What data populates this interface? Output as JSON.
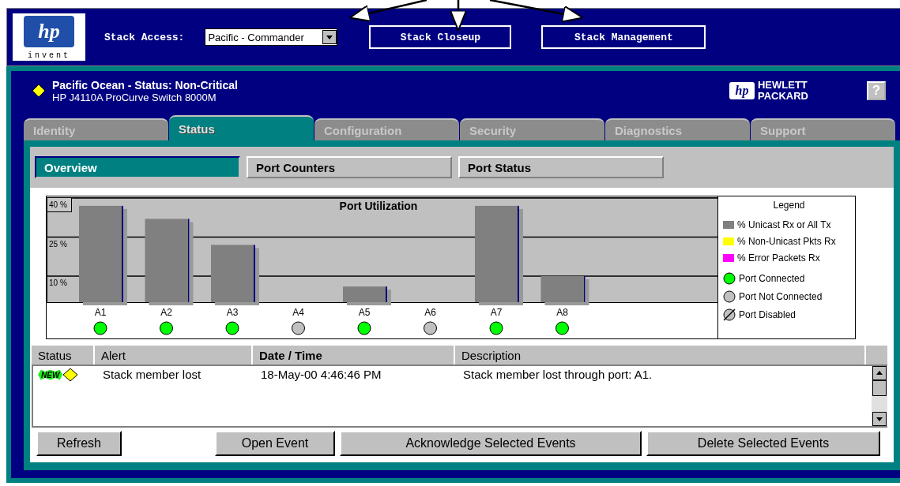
{
  "header": {
    "logo": {
      "mark": "hp",
      "tagline": "invent"
    },
    "stack_access": {
      "label": "Stack Access:",
      "value": "Pacific - Commander"
    },
    "buttons": [
      "Stack Closeup",
      "Stack Management"
    ]
  },
  "device": {
    "title": "Pacific Ocean - Status: Non-Critical",
    "color": "#ffff00",
    "model": "HP J4110A ProCurve Switch 8000M",
    "brand": {
      "mark": "hp",
      "line1": "HEWLETT",
      "line2": "PACKARD"
    },
    "help": "?"
  },
  "tabs": [
    {
      "label": "Identity",
      "selected": false
    },
    {
      "label": "Status",
      "selected": true
    },
    {
      "label": "Configuration",
      "selected": false
    },
    {
      "label": "Security",
      "selected": false
    },
    {
      "label": "Diagnostics",
      "selected": false
    },
    {
      "label": "Support",
      "selected": false
    }
  ],
  "subtabs": [
    {
      "label": "Overview",
      "selected": true
    },
    {
      "label": "Port Counters",
      "selected": false
    },
    {
      "label": "Port Status",
      "selected": false
    }
  ],
  "chart": {
    "chart_data": {
      "type": "bar",
      "title": "Port Utilization",
      "categories": [
        "A1",
        "A2",
        "A3",
        "A4",
        "A5",
        "A6",
        "A7",
        "A8"
      ],
      "series": [
        {
          "color": "#808080",
          "values": [
            37,
            32,
            22,
            0,
            6,
            0,
            37,
            10
          ]
        }
      ],
      "ylim": [
        0,
        40
      ],
      "yticks": [
        {
          "value": 10,
          "label": "10 %"
        },
        {
          "value": 25,
          "label": "25 %"
        },
        {
          "value": 40,
          "label": "40 %"
        }
      ]
    },
    "port_links": [
      {
        "connected": true
      },
      {
        "connected": true
      },
      {
        "connected": true
      },
      {
        "connected": false
      },
      {
        "connected": true
      },
      {
        "connected": false
      },
      {
        "connected": true
      },
      {
        "connected": true
      }
    ]
  },
  "legend": {
    "title": "Legend",
    "items": [
      {
        "kind": "swatch",
        "color": "#808080",
        "label": "% Unicast Rx or All Tx"
      },
      {
        "kind": "swatch",
        "color": "#ffff00",
        "label": "% Non-Unicast Pkts Rx"
      },
      {
        "kind": "swatch",
        "color": "#ff00ff",
        "label": "% Error Packets Rx"
      },
      {
        "kind": "connected",
        "label": "Port Connected"
      },
      {
        "kind": "not-connected",
        "label": "Port Not Connected"
      },
      {
        "kind": "disabled",
        "label": "Port Disabled"
      }
    ]
  },
  "events": {
    "columns": [
      {
        "label": "Status",
        "sorted": false
      },
      {
        "label": "Alert",
        "sorted": false
      },
      {
        "label": "Date / Time",
        "sorted": true
      },
      {
        "label": "Description",
        "sorted": false
      }
    ],
    "rows": [
      {
        "badge": "NEW",
        "color": "#ffff00",
        "alert": "Stack member lost",
        "time": "18-May-00 4:46:46 PM",
        "description": "Stack member lost through port: A1."
      }
    ]
  },
  "buttons": [
    "Refresh",
    "Open Event",
    "Acknowledge Selected Events",
    "Delete Selected Events"
  ]
}
